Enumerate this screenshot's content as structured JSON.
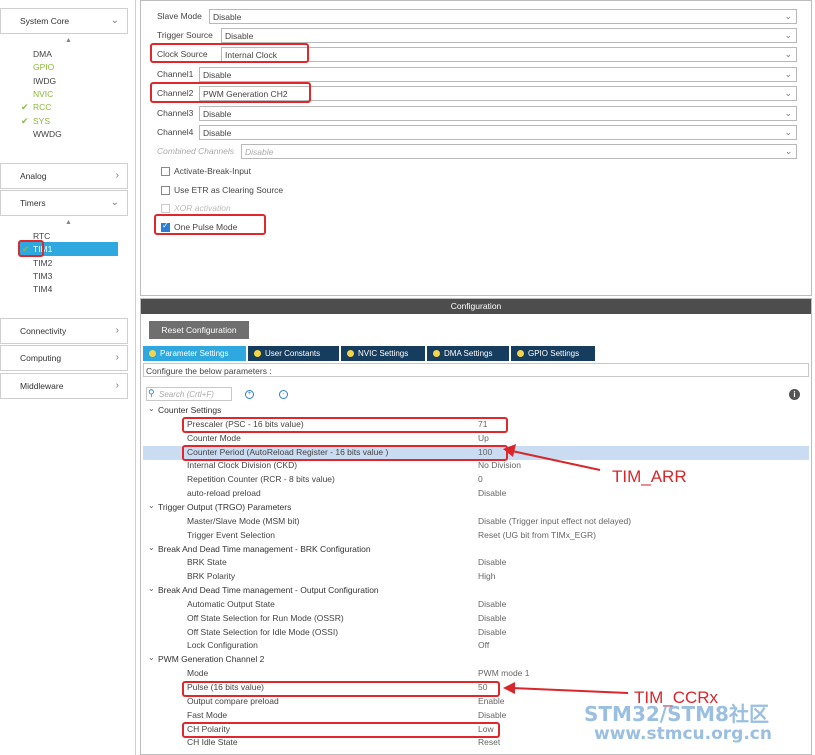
{
  "sidebar": {
    "system_core": "System Core",
    "system_core_items": [
      {
        "label": "DMA",
        "color": "normal",
        "checked": false
      },
      {
        "label": "GPIO",
        "color": "green",
        "checked": false
      },
      {
        "label": "IWDG",
        "color": "normal",
        "checked": false
      },
      {
        "label": "NVIC",
        "color": "green",
        "checked": false
      },
      {
        "label": "RCC",
        "color": "green",
        "checked": true
      },
      {
        "label": "SYS",
        "color": "green",
        "checked": true
      },
      {
        "label": "WWDG",
        "color": "normal",
        "checked": false
      }
    ],
    "analog": "Analog",
    "timers": "Timers",
    "timer_items": [
      {
        "label": "RTC",
        "checked": false
      },
      {
        "label": "TIM1",
        "checked": true,
        "selected": true
      },
      {
        "label": "TIM2",
        "checked": false
      },
      {
        "label": "TIM3",
        "checked": false
      },
      {
        "label": "TIM4",
        "checked": false
      }
    ],
    "connectivity": "Connectivity",
    "computing": "Computing",
    "middleware": "Middleware"
  },
  "mode": {
    "rows": [
      {
        "label": "Slave Mode",
        "value": "Disable"
      },
      {
        "label": "Trigger Source",
        "value": "Disable"
      },
      {
        "label": "Clock Source",
        "value": "Internal Clock"
      },
      {
        "label": "Channel1",
        "value": "Disable"
      },
      {
        "label": "Channel2",
        "value": "PWM Generation CH2"
      },
      {
        "label": "Channel3",
        "value": "Disable"
      },
      {
        "label": "Channel4",
        "value": "Disable"
      },
      {
        "label": "Combined Channels",
        "value": "Disable"
      }
    ],
    "checks": [
      {
        "label": "Activate-Break-Input",
        "checked": false
      },
      {
        "label": "Use ETR as Clearing Source",
        "checked": false
      },
      {
        "label": "XOR activation",
        "checked": false
      },
      {
        "label": "One Pulse Mode",
        "checked": true
      }
    ]
  },
  "config": {
    "header": "Configuration",
    "reset_button": "Reset Configuration",
    "tabs": [
      "Parameter Settings",
      "User Constants",
      "NVIC Settings",
      "DMA Settings",
      "GPIO Settings"
    ],
    "message": "Configure the below parameters :",
    "search_placeholder": "Search (Crtl+F)",
    "info": "i",
    "rows": [
      {
        "type": "group",
        "name": "Counter Settings",
        "value": ""
      },
      {
        "type": "param",
        "name": "Prescaler (PSC - 16 bits value)",
        "value": "71"
      },
      {
        "type": "param",
        "name": "Counter Mode",
        "value": "Up"
      },
      {
        "type": "param",
        "name": "Counter Period (AutoReload Register - 16 bits value )",
        "value": "100"
      },
      {
        "type": "param",
        "name": "Internal Clock Division (CKD)",
        "value": "No Division"
      },
      {
        "type": "param",
        "name": "Repetition Counter (RCR - 8 bits value)",
        "value": "0"
      },
      {
        "type": "param",
        "name": "auto-reload preload",
        "value": "Disable"
      },
      {
        "type": "group",
        "name": "Trigger Output (TRGO) Parameters",
        "value": ""
      },
      {
        "type": "param",
        "name": "Master/Slave Mode (MSM bit)",
        "value": "Disable (Trigger input effect not delayed)"
      },
      {
        "type": "param",
        "name": "Trigger Event Selection",
        "value": "Reset (UG bit from TIMx_EGR)"
      },
      {
        "type": "group",
        "name": "Break And Dead Time management - BRK Configuration",
        "value": ""
      },
      {
        "type": "param",
        "name": "BRK State",
        "value": "Disable"
      },
      {
        "type": "param",
        "name": "BRK Polarity",
        "value": "High"
      },
      {
        "type": "group",
        "name": "Break And Dead Time management - Output Configuration",
        "value": ""
      },
      {
        "type": "param",
        "name": "Automatic Output State",
        "value": "Disable"
      },
      {
        "type": "param",
        "name": "Off State Selection for Run Mode (OSSR)",
        "value": "Disable"
      },
      {
        "type": "param",
        "name": "Off State Selection for Idle Mode (OSSI)",
        "value": "Disable"
      },
      {
        "type": "param",
        "name": "Lock Configuration",
        "value": "Off"
      },
      {
        "type": "group",
        "name": "PWM Generation Channel 2",
        "value": ""
      },
      {
        "type": "param",
        "name": "Mode",
        "value": "PWM mode 1"
      },
      {
        "type": "param",
        "name": "Pulse (16 bits value)",
        "value": "50"
      },
      {
        "type": "param",
        "name": "Output compare preload",
        "value": "Enable"
      },
      {
        "type": "param",
        "name": "Fast Mode",
        "value": "Disable"
      },
      {
        "type": "param",
        "name": "CH Polarity",
        "value": "Low"
      },
      {
        "type": "param",
        "name": "CH Idle State",
        "value": "Reset"
      }
    ]
  },
  "annotations": {
    "arr": "TIM_ARR",
    "ccr": "TIM_CCRx"
  },
  "watermark": {
    "line1": "STM32/STM8社区",
    "line2": "www.stmcu.org.cn"
  },
  "colors": {
    "accent": "#2fa8df",
    "highlight": "#e0282c",
    "active_green": "#8ab83a",
    "tab_bg": "#163c5e"
  }
}
